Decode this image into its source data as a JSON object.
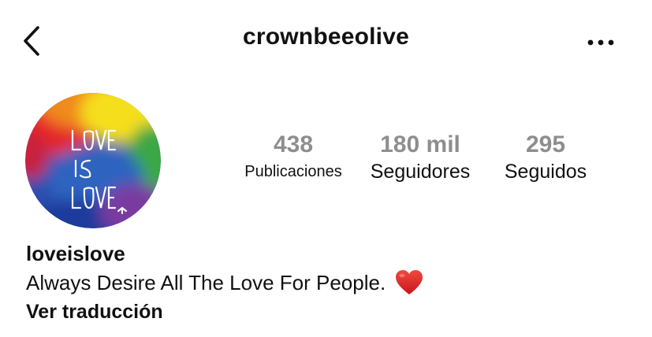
{
  "header": {
    "username": "crownbeeolive",
    "back_icon": "chevron-left-icon",
    "more_icon": "more-horizontal-icon"
  },
  "avatar": {
    "text_lines": [
      "LOVE",
      "IS",
      "LOVE"
    ],
    "colors": [
      "#e8262b",
      "#f7941d",
      "#f4e11e",
      "#3dae49",
      "#2b5fb4",
      "#1f3fa3",
      "#8b3ea0"
    ]
  },
  "stats": {
    "posts": {
      "value": "438",
      "label": "Publicaciones"
    },
    "followers": {
      "value": "180 mil",
      "label": "Seguidores"
    },
    "following": {
      "value": "295",
      "label": "Seguidos"
    }
  },
  "bio": {
    "name": "loveislove",
    "text": "Always Desire All The Love For People.",
    "emoji_icon": "red-heart-icon",
    "translate_link": "Ver traducción"
  }
}
